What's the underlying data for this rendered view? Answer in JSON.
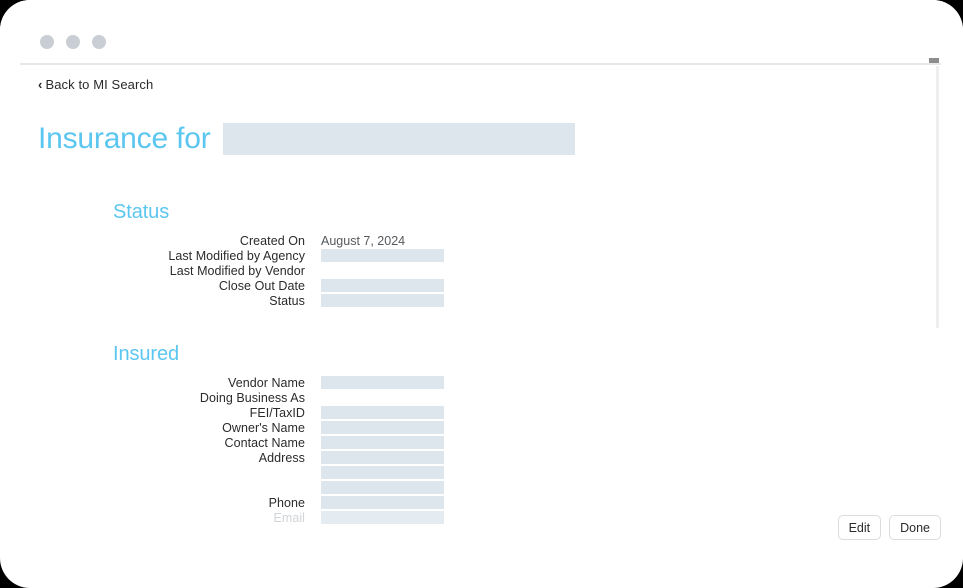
{
  "window": {
    "dots": [
      "minimize-dot",
      "maximize-dot",
      "close-dot"
    ]
  },
  "nav": {
    "back_chevron": "‹",
    "back_label": "Back to MI Search"
  },
  "header": {
    "title": "Insurance for",
    "title_value": ""
  },
  "colors": {
    "accent": "#5bc6ef",
    "placeholder_bar": "#dce6ec",
    "label_text": "#2b2b2b",
    "window_dot": "#c9ced4",
    "scrollbar_thumb": "#8d8d8d"
  },
  "sections": [
    {
      "id": "status",
      "heading": "Status",
      "fields": [
        {
          "label": "Created On",
          "type": "text",
          "value": "August 7, 2024"
        },
        {
          "label": "Last Modified by Agency",
          "type": "bar",
          "value": ""
        },
        {
          "label": "Last Modified by Vendor",
          "type": "empty",
          "value": ""
        },
        {
          "label": "Close Out Date",
          "type": "bar",
          "value": ""
        },
        {
          "label": "Status",
          "type": "bar",
          "value": ""
        }
      ]
    },
    {
      "id": "insured",
      "heading": "Insured",
      "fields": [
        {
          "label": "Vendor Name",
          "type": "bar",
          "value": ""
        },
        {
          "label": "Doing Business As",
          "type": "empty",
          "value": ""
        },
        {
          "label": "FEI/TaxID",
          "type": "bar",
          "value": ""
        },
        {
          "label": "Owner's Name",
          "type": "bar",
          "value": ""
        },
        {
          "label": "Contact Name",
          "type": "bar",
          "value": ""
        },
        {
          "label": "Address",
          "type": "bar",
          "value": ""
        },
        {
          "label": "",
          "type": "bar",
          "value": ""
        },
        {
          "label": "",
          "type": "bar",
          "value": ""
        },
        {
          "label": "Phone",
          "type": "bar",
          "value": ""
        },
        {
          "label": "Email",
          "type": "bar",
          "value": "",
          "faded": true
        }
      ]
    }
  ],
  "footer": {
    "buttons": [
      {
        "name": "edit-button",
        "label": "Edit"
      },
      {
        "name": "done-button",
        "label": "Done"
      }
    ]
  }
}
